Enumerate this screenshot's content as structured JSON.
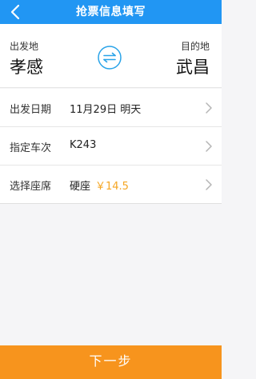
{
  "header": {
    "title": "抢票信息填写"
  },
  "route": {
    "from_label": "出发地",
    "from_city": "孝感",
    "to_label": "目的地",
    "to_city": "武昌"
  },
  "form": {
    "date_label": "出发日期",
    "date_value": "11月29日 明天",
    "train_label": "指定车次",
    "train_value": "K243",
    "seat_label": "选择座席",
    "seat_value": "硬座",
    "seat_price": "￥14.5"
  },
  "footer": {
    "next_label": "下一步"
  },
  "colors": {
    "header_bg": "#2196F3",
    "accent_price": "#F5A623",
    "button_bg": "#F7941D"
  },
  "icons": [
    "back-arrow-icon",
    "swap-icon",
    "chevron-right-icon"
  ]
}
